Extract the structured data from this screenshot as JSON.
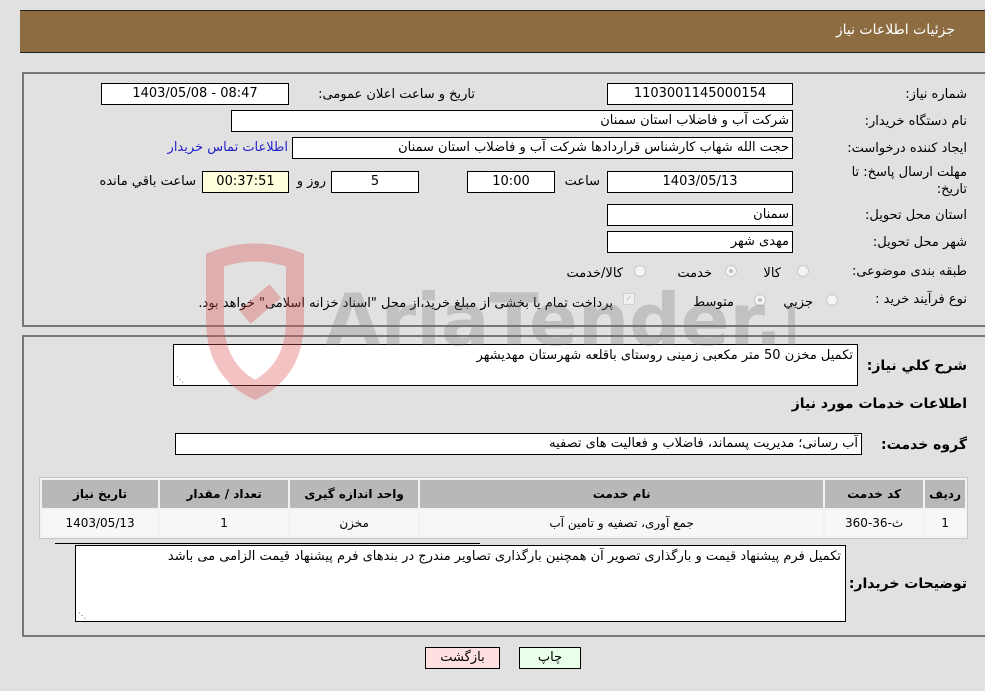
{
  "header": {
    "title": "جزئیات اطلاعات نیاز"
  },
  "details": {
    "need_number_label": "شماره نیاز:",
    "need_number": "1103001145000154",
    "announce_label": "تاریخ و ساعت اعلان عمومی:",
    "announce_value": "1403/05/08 - 08:47",
    "buyer_org_label": "نام دستگاه خریدار:",
    "buyer_org": "شرکت آب و فاضلاب استان سمنان",
    "creator_label": "ایجاد کننده درخواست:",
    "creator": "حجت الله شهاب کارشناس قراردادها شرکت آب و فاضلاب استان سمنان",
    "buyer_contact_link": "اطلاعات تماس خریدار",
    "deadline_label": "مهلت ارسال پاسخ: تا تاریخ:",
    "deadline_date": "1403/05/13",
    "time_label": "ساعت",
    "deadline_time": "10:00",
    "days_value": "5",
    "days_label": "روز و",
    "remaining_time": "00:37:51",
    "remaining_label": "ساعت باقي مانده",
    "province_label": "استان محل تحویل:",
    "province": "سمنان",
    "city_label": "شهر محل تحویل:",
    "city": "مهدی شهر",
    "category_label": "طبقه بندی موضوعی:",
    "category_options": [
      {
        "label": "کالا",
        "checked": false
      },
      {
        "label": "خدمت",
        "checked": true
      },
      {
        "label": "کالا/خدمت",
        "checked": false
      }
    ],
    "process_label": "نوع فرآیند خرید :",
    "process_options": [
      {
        "label": "جزيي",
        "checked": false
      },
      {
        "label": "متوسط",
        "checked": true
      }
    ],
    "treasury_note": "پرداخت تمام یا بخشی از مبلغ خرید،از محل \"اسناد خزانه اسلامی\" خواهد بود.",
    "treasury_checked": true
  },
  "summary": {
    "description_label": "شرح کلي نیاز:",
    "description": "تکمیل مخزن 50 متر مکعبی زمینی روستای باقلعه شهرستان مهدیشهر",
    "services_heading": "اطلاعات خدمات مورد نیاز",
    "service_group_label": "گروه خدمت:",
    "service_group": "آب رسانی؛ مدیریت پسماند، فاضلاب و فعالیت های تصفیه"
  },
  "table": {
    "headers": [
      "ردیف",
      "کد خدمت",
      "نام خدمت",
      "واحد اندازه گیری",
      "تعداد / مقدار",
      "تاریخ نیاز"
    ],
    "rows": [
      [
        "1",
        "ث-36-360",
        "جمع آوری، تصفیه و تامین آب",
        "مخزن",
        "1",
        "1403/05/13"
      ]
    ]
  },
  "buyer_notes": {
    "label": "توضیحات خریدار:",
    "text": "تکمیل فرم پیشنهاد قیمت و بارگذاری تصویر آن همچنین بارگذاری تصاویر مندرج در بندهای فرم پیشنهاد قیمت الزامی می باشد"
  },
  "buttons": {
    "print": "چاپ",
    "back": "بازگشت"
  },
  "watermark": {
    "text": "AriaTender.neT"
  }
}
